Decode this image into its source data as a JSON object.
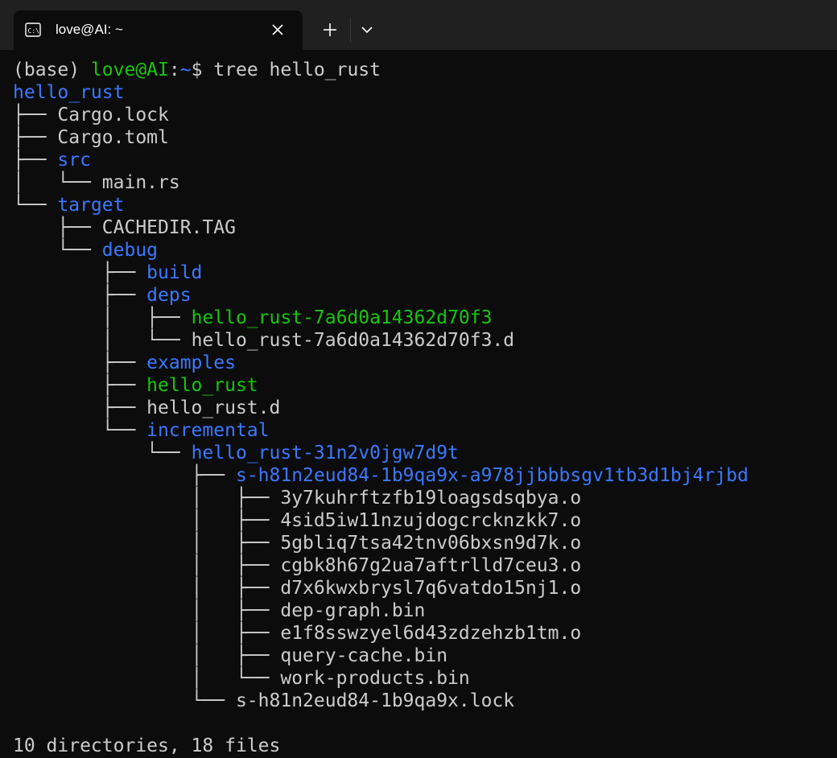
{
  "tab": {
    "title": "love@AI: ~",
    "icon": "terminal-icon",
    "close_icon": "close-icon",
    "new_tab_icon": "plus-icon",
    "dropdown_icon": "chevron-down-icon"
  },
  "colors": {
    "background": "#0c0c0c",
    "titlebar": "#202020",
    "default_text": "#cccccc",
    "green": "#16c60c",
    "blue": "#3b78ff"
  },
  "lines": [
    [
      {
        "t": "(base) ",
        "c": "default"
      },
      {
        "t": "love@AI",
        "c": "green"
      },
      {
        "t": ":",
        "c": "default"
      },
      {
        "t": "~",
        "c": "blue"
      },
      {
        "t": "$ tree hello_rust",
        "c": "default"
      }
    ],
    [
      {
        "t": "hello_rust",
        "c": "blue"
      }
    ],
    [
      {
        "t": "├── ",
        "c": "default"
      },
      {
        "t": "Cargo.lock",
        "c": "default"
      }
    ],
    [
      {
        "t": "├── ",
        "c": "default"
      },
      {
        "t": "Cargo.toml",
        "c": "default"
      }
    ],
    [
      {
        "t": "├── ",
        "c": "default"
      },
      {
        "t": "src",
        "c": "blue"
      }
    ],
    [
      {
        "t": "│   └── ",
        "c": "default"
      },
      {
        "t": "main.rs",
        "c": "default"
      }
    ],
    [
      {
        "t": "└── ",
        "c": "default"
      },
      {
        "t": "target",
        "c": "blue"
      }
    ],
    [
      {
        "t": "    ├── ",
        "c": "default"
      },
      {
        "t": "CACHEDIR.TAG",
        "c": "default"
      }
    ],
    [
      {
        "t": "    └── ",
        "c": "default"
      },
      {
        "t": "debug",
        "c": "blue"
      }
    ],
    [
      {
        "t": "        ├── ",
        "c": "default"
      },
      {
        "t": "build",
        "c": "blue"
      }
    ],
    [
      {
        "t": "        ├── ",
        "c": "default"
      },
      {
        "t": "deps",
        "c": "blue"
      }
    ],
    [
      {
        "t": "        │   ├── ",
        "c": "default"
      },
      {
        "t": "hello_rust-7a6d0a14362d70f3",
        "c": "green"
      }
    ],
    [
      {
        "t": "        │   └── ",
        "c": "default"
      },
      {
        "t": "hello_rust-7a6d0a14362d70f3.d",
        "c": "default"
      }
    ],
    [
      {
        "t": "        ├── ",
        "c": "default"
      },
      {
        "t": "examples",
        "c": "blue"
      }
    ],
    [
      {
        "t": "        ├── ",
        "c": "default"
      },
      {
        "t": "hello_rust",
        "c": "green"
      }
    ],
    [
      {
        "t": "        ├── ",
        "c": "default"
      },
      {
        "t": "hello_rust.d",
        "c": "default"
      }
    ],
    [
      {
        "t": "        └── ",
        "c": "default"
      },
      {
        "t": "incremental",
        "c": "blue"
      }
    ],
    [
      {
        "t": "            └── ",
        "c": "default"
      },
      {
        "t": "hello_rust-31n2v0jgw7d9t",
        "c": "blue"
      }
    ],
    [
      {
        "t": "                ├── ",
        "c": "default"
      },
      {
        "t": "s-h81n2eud84-1b9qa9x-a978jjbbbsgv1tb3d1bj4rjbd",
        "c": "blue"
      }
    ],
    [
      {
        "t": "                │   ├── ",
        "c": "default"
      },
      {
        "t": "3y7kuhrftzfb19loagsdsqbya.o",
        "c": "default"
      }
    ],
    [
      {
        "t": "                │   ├── ",
        "c": "default"
      },
      {
        "t": "4sid5iw11nzujdogcrcknzkk7.o",
        "c": "default"
      }
    ],
    [
      {
        "t": "                │   ├── ",
        "c": "default"
      },
      {
        "t": "5gbliq7tsa42tnv06bxsn9d7k.o",
        "c": "default"
      }
    ],
    [
      {
        "t": "                │   ├── ",
        "c": "default"
      },
      {
        "t": "cgbk8h67g2ua7aftrlld7ceu3.o",
        "c": "default"
      }
    ],
    [
      {
        "t": "                │   ├── ",
        "c": "default"
      },
      {
        "t": "d7x6kwxbrysl7q6vatdo15nj1.o",
        "c": "default"
      }
    ],
    [
      {
        "t": "                │   ├── ",
        "c": "default"
      },
      {
        "t": "dep-graph.bin",
        "c": "default"
      }
    ],
    [
      {
        "t": "                │   ├── ",
        "c": "default"
      },
      {
        "t": "e1f8sswzyel6d43zdzehzb1tm.o",
        "c": "default"
      }
    ],
    [
      {
        "t": "                │   ├── ",
        "c": "default"
      },
      {
        "t": "query-cache.bin",
        "c": "default"
      }
    ],
    [
      {
        "t": "                │   └── ",
        "c": "default"
      },
      {
        "t": "work-products.bin",
        "c": "default"
      }
    ],
    [
      {
        "t": "                └── ",
        "c": "default"
      },
      {
        "t": "s-h81n2eud84-1b9qa9x.lock",
        "c": "default"
      }
    ],
    [],
    [
      {
        "t": "10 directories, 18 files",
        "c": "default"
      }
    ]
  ]
}
